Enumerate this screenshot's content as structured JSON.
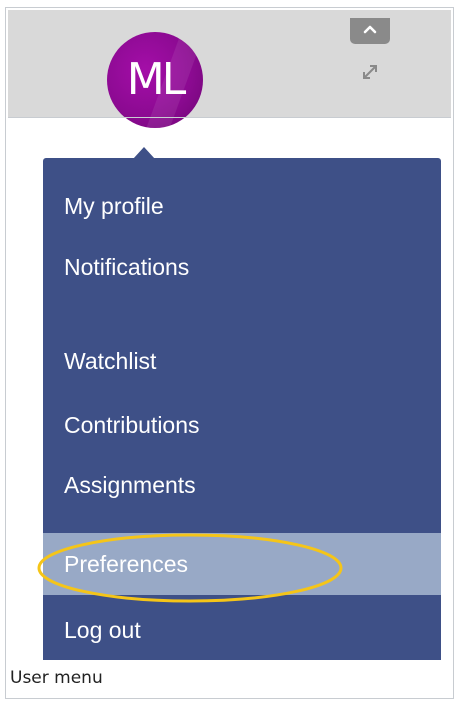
{
  "user": {
    "initials": "ML"
  },
  "header": {
    "collapse_icon": "chevron-up-icon",
    "expand_icon": "expand-arrows-icon"
  },
  "menu": {
    "items": [
      {
        "label": "My profile"
      },
      {
        "label": "Notifications"
      },
      {
        "label": "Watchlist"
      },
      {
        "label": "Contributions"
      },
      {
        "label": "Assignments"
      },
      {
        "label": "Preferences",
        "active": true,
        "highlighted": true
      },
      {
        "label": "Log out"
      }
    ]
  },
  "caption": "User menu",
  "colors": {
    "menu_background": "#3e5087",
    "active_item_background": "#98a9c6",
    "highlight_ellipse": "#f5c518",
    "avatar": "#8c0a92",
    "header_background": "#d9d9d9"
  }
}
